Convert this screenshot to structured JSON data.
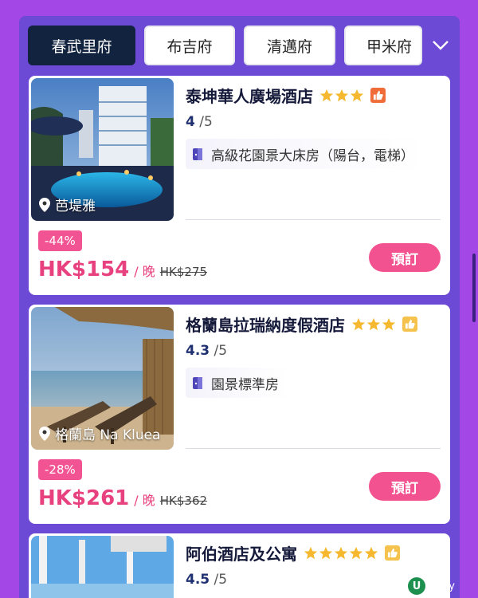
{
  "tabs": [
    {
      "label": "春武里府",
      "active": true
    },
    {
      "label": "布吉府",
      "active": false
    },
    {
      "label": "清邁府",
      "active": false
    },
    {
      "label": "甲米府",
      "active": false
    }
  ],
  "more_icon": "chevron-down-icon",
  "hotels": [
    {
      "name": "泰坤華人廣場酒店",
      "stars": 3,
      "thumb_color": "#f06d3a",
      "rating": "4",
      "rating_max": "/5",
      "room": "高級花園景大床房（陽台，電梯）",
      "location": "芭堤雅",
      "discount": "-44%",
      "price": "HK$154",
      "per": "/ 晚",
      "old_price": "HK$275",
      "book": "預訂"
    },
    {
      "name": "格蘭島拉瑞納度假酒店",
      "stars": 3,
      "thumb_color": "#f5c24d",
      "rating": "4.3",
      "rating_max": "/5",
      "room": "園景標準房",
      "location": "格蘭島 Na Kluea",
      "discount": "-28%",
      "price": "HK$261",
      "per": "/ 晚",
      "old_price": "HK$362",
      "book": "預訂"
    },
    {
      "name": "阿伯酒店及公寓",
      "stars": 5,
      "thumb_color": "#f5c24d",
      "rating": "4.5",
      "rating_max": "/5"
    }
  ],
  "watermark": {
    "logo": "U",
    "text": "unity"
  },
  "colors": {
    "background": "#a347e6",
    "panel": "#6d4ad6",
    "accent": "#f2528f",
    "star": "#f5b82e",
    "navy": "#12233f"
  }
}
